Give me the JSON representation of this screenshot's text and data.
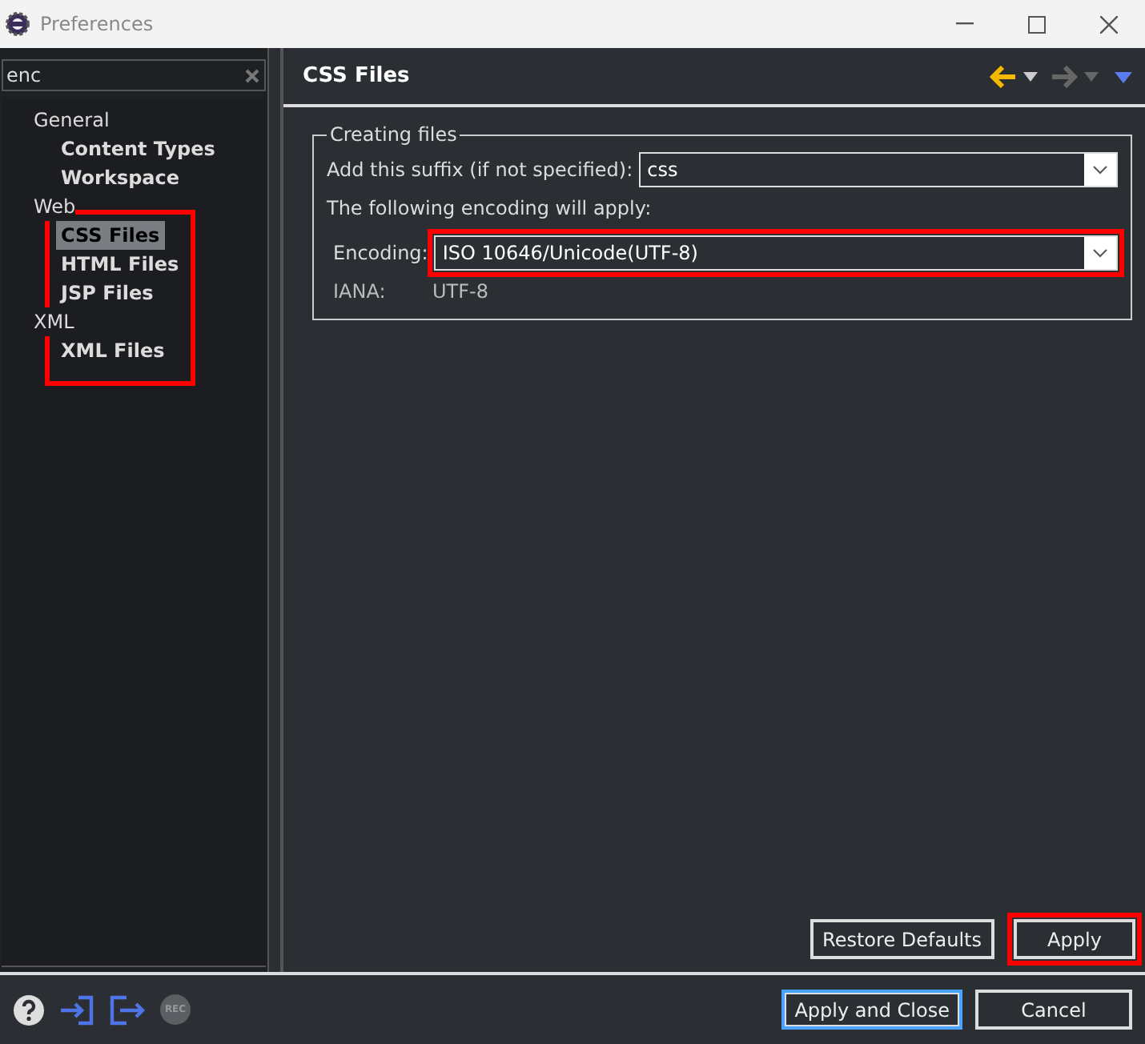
{
  "window": {
    "title": "Preferences"
  },
  "filter": {
    "value": "enc"
  },
  "tree": [
    {
      "label": "General",
      "children": [
        {
          "label": "Content Types",
          "selected": false
        },
        {
          "label": "Workspace",
          "selected": false
        }
      ]
    },
    {
      "label": "Web",
      "children": [
        {
          "label": "CSS Files",
          "selected": true
        },
        {
          "label": "HTML Files",
          "selected": false
        },
        {
          "label": "JSP Files",
          "selected": false
        }
      ]
    },
    {
      "label": "XML",
      "children": [
        {
          "label": "XML Files",
          "selected": false
        }
      ]
    }
  ],
  "page": {
    "title": "CSS Files"
  },
  "group": {
    "title": "Creating files",
    "suffix": {
      "label": "Add this suffix (if not specified):",
      "value": "css"
    },
    "note": "The following encoding will apply:",
    "encoding": {
      "label": "Encoding:",
      "value": "ISO 10646/Unicode(UTF-8)",
      "highlighted": true
    },
    "iana": {
      "label": "IANA:",
      "value": "UTF-8"
    }
  },
  "page_buttons": [
    {
      "label": "Restore Defaults",
      "highlighted": false
    },
    {
      "label": "Apply",
      "highlighted": true
    }
  ],
  "tree_highlighted": true,
  "rec_label": "REC",
  "dialog_buttons": [
    {
      "label": "Apply and Close",
      "default": true
    },
    {
      "label": "Cancel",
      "default": false
    }
  ]
}
